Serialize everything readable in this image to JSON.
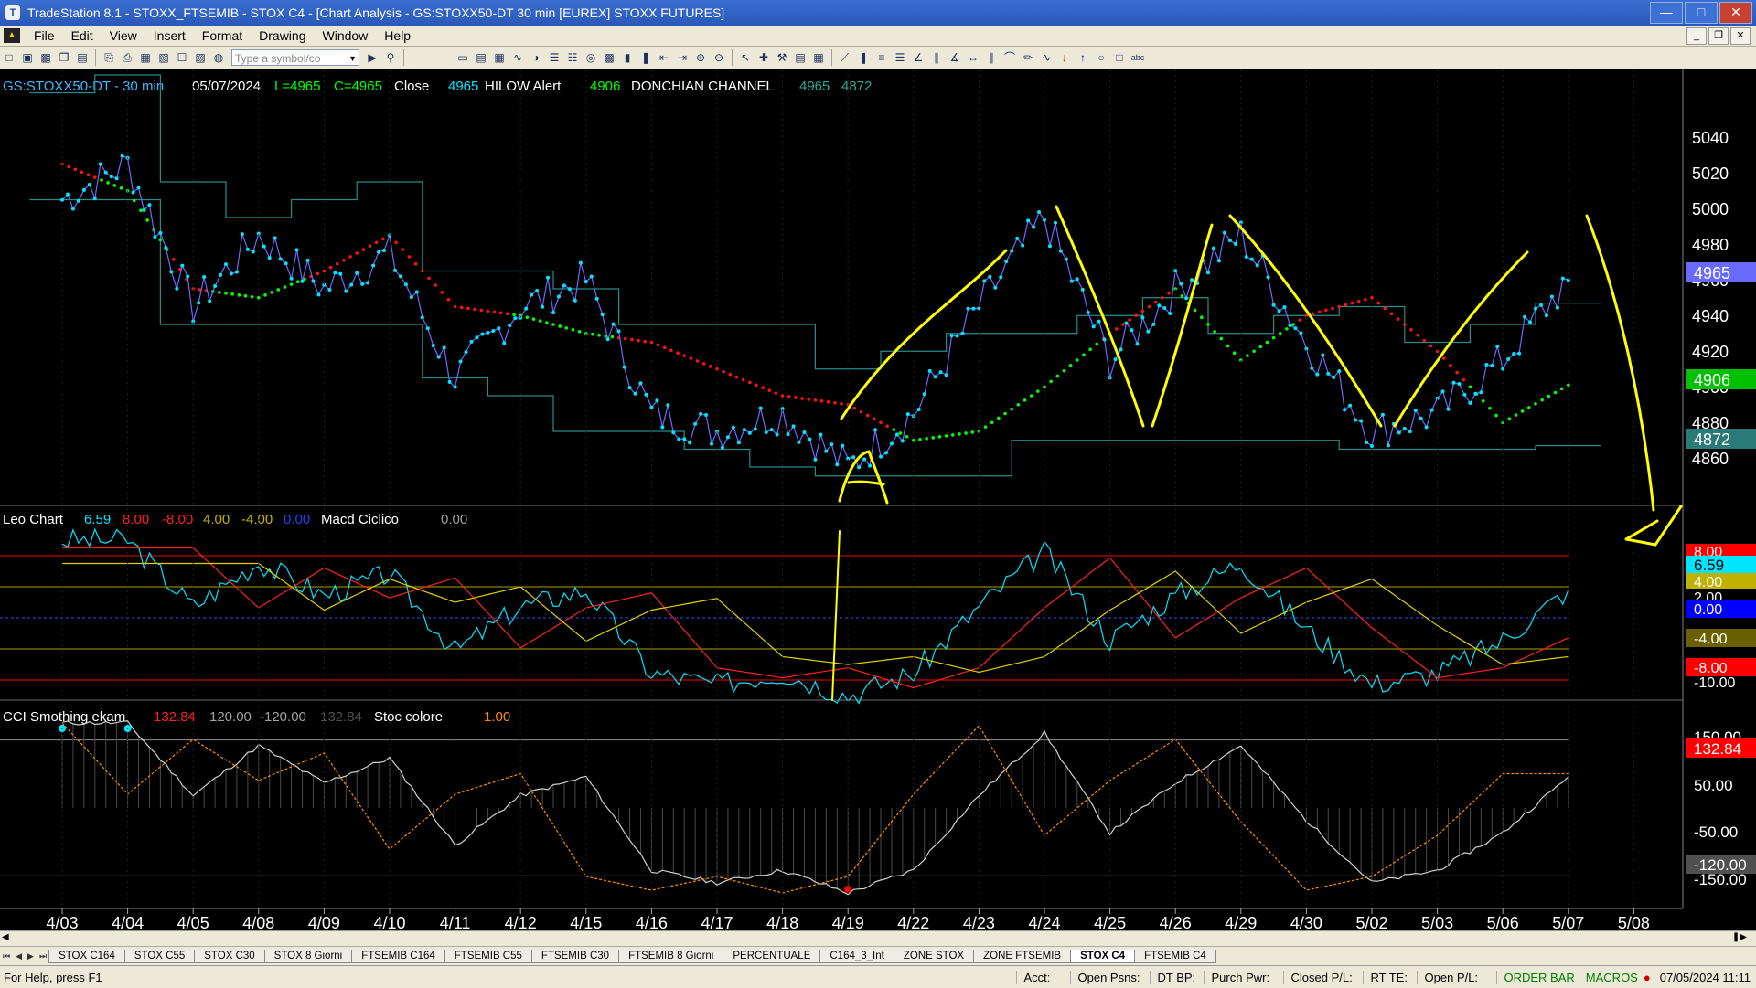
{
  "window": {
    "title": "TradeStation 8.1 - STOXX_FTSEMIB - STOX  C4 - [Chart Analysis - GS:STOXX50-DT  30 min  [EUREX] STOXX FUTURES]"
  },
  "menu": [
    "File",
    "Edit",
    "View",
    "Insert",
    "Format",
    "Drawing",
    "Window",
    "Help"
  ],
  "toolbar": {
    "symbol_placeholder": "Type a symbol/co"
  },
  "chart": {
    "header": {
      "symbol": "GS:STOXX50-DT - 30 min",
      "date": "05/07/2024",
      "low": "L=4965",
      "close": "C=4965",
      "close_label": "Close",
      "close_val": "4965",
      "hilow": "HILOW Alert",
      "hilow_val": "4906",
      "donchian": "DONCHIAN CHANNEL",
      "don1": "4965",
      "don2": "4872"
    },
    "price_axis": [
      "5040",
      "5020",
      "5000",
      "4980",
      "4960",
      "4940",
      "4920",
      "4900",
      "4880",
      "4860"
    ],
    "price_tags": {
      "last": "4965",
      "hilow": "4906",
      "donchian": "4872"
    },
    "annotation": "A",
    "panel2": {
      "title": "Leo Chart",
      "v1": "6.59",
      "v2": "8.00",
      "v3": "-8.00",
      "v4": "4.00",
      "v5": "-4.00",
      "v6": "0.00",
      "macd": "Macd Ciclico",
      "macd_val": "0.00",
      "axis": [
        "8.00",
        "6.59",
        "4.00",
        "2.00",
        "0.00",
        "-4.00",
        "-8.00",
        "-10.00"
      ]
    },
    "panel3": {
      "title": "CCI Smothing ekam",
      "v1": "132.84",
      "v2": "120.00",
      "v3": "-120.00",
      "v4": "132.84",
      "stoc": "Stoc colore",
      "stoc_val": "1.00",
      "axis": [
        "150.00",
        "132.84",
        "50.00",
        "-50.00",
        "-120.00",
        "-150.00"
      ]
    },
    "dates": [
      "4/03",
      "4/04",
      "4/05",
      "4/08",
      "4/09",
      "4/10",
      "4/11",
      "4/12",
      "4/15",
      "4/16",
      "4/17",
      "4/18",
      "4/19",
      "4/22",
      "4/23",
      "4/24",
      "4/25",
      "4/26",
      "4/29",
      "4/30",
      "5/02",
      "5/03",
      "5/06",
      "5/07",
      "5/08"
    ]
  },
  "chart_data": {
    "type": "line",
    "title": "GS:STOXX50-DT - 30 min",
    "x": [
      "4/03",
      "4/04",
      "4/05",
      "4/08",
      "4/09",
      "4/10",
      "4/11",
      "4/12",
      "4/15",
      "4/16",
      "4/17",
      "4/18",
      "4/19",
      "4/22",
      "4/23",
      "4/24",
      "4/25",
      "4/26",
      "4/29",
      "4/30",
      "5/02",
      "5/03",
      "5/06",
      "5/07"
    ],
    "series": [
      {
        "name": "Close",
        "values": [
          5010,
          5030,
          4950,
          4990,
          4960,
          4980,
          4910,
          4950,
          4965,
          4890,
          4880,
          4890,
          4860,
          4890,
          4950,
          5000,
          4920,
          4960,
          4990,
          4930,
          4880,
          4890,
          4920,
          4965
        ]
      },
      {
        "name": "HILOW Alert",
        "values": [
          5030,
          5015,
          4960,
          4955,
          4970,
          4990,
          4950,
          4945,
          4935,
          4930,
          4915,
          4900,
          4895,
          4875,
          4880,
          4905,
          4935,
          4960,
          4920,
          4945,
          4955,
          4925,
          4885,
          4906
        ]
      },
      {
        "name": "DONCHIAN CHANNEL",
        "values": [
          5010,
          5010,
          4940,
          4940,
          4940,
          4940,
          4910,
          4900,
          4880,
          4880,
          4870,
          4860,
          4855,
          4855,
          4855,
          4875,
          4875,
          4875,
          4875,
          4875,
          4870,
          4870,
          4870,
          4872
        ]
      }
    ],
    "ylim": [
      4850,
      5050
    ]
  },
  "tabs": [
    "STOX C164",
    "STOX C55",
    "STOX  C30",
    "STOX  8 Giorni",
    "FTSEMIB C164",
    "FTSEMIB C55",
    "FTSEMIB C30",
    "FTSEMIB  8 Giorni",
    "PERCENTUALE",
    "C164_3_Int",
    "ZONE STOX",
    "ZONE FTSEMIB",
    "STOX  C4",
    "FTSEMIB C4"
  ],
  "active_tab": "STOX  C4",
  "status": {
    "help": "For Help, press F1",
    "acct": "Acct:",
    "open_psns": "Open Psns:",
    "dt_bp": "DT BP:",
    "purch_pwr": "Purch Pwr:",
    "closed_pl": "Closed P/L:",
    "rt_te": "RT TE:",
    "open_pl": "Open P/L:",
    "order_bar": "ORDER BAR",
    "macros": "MACROS",
    "datetime": "07/05/2024 11:11"
  },
  "colors": {
    "bg": "#000000",
    "price": "#00e5ff",
    "hilow_red": "#ff1010",
    "hilow_green": "#00ff00",
    "donchian": "#2a8a8a",
    "yellow": "#ffff00"
  }
}
